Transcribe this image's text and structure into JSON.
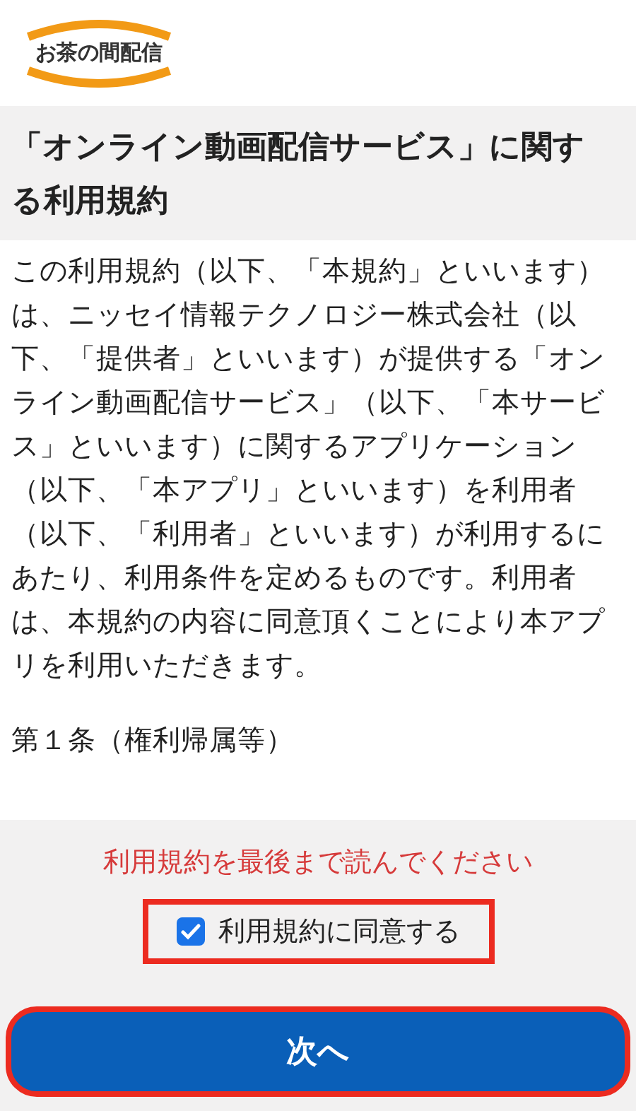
{
  "header": {
    "logo_text": "お茶の間配信"
  },
  "title": "「オンライン動画配信サービス」に関する利用規約",
  "terms": {
    "paragraphs": [
      "この利用規約（以下、「本規約」といいます）は、ニッセイ情報テクノロジー株式会社（以下、「提供者」といいます）が提供する「オンライン動画配信サービス」（以下、「本サービス」といいます）に関するアプリケーション（以下、「本アプリ」といいます）を利用者（以下、「利用者」といいます）が利用するにあたり、利用条件を定めるものです。利用者は、本規約の内容に同意頂くことにより本アプリを利用いただきます。"
    ],
    "article_heading": "第１条（権利帰属等）"
  },
  "warning": "利用規約を最後まで読んでください",
  "agree": {
    "label": "利用規約に同意する",
    "checked": true
  },
  "next_button": "次へ"
}
